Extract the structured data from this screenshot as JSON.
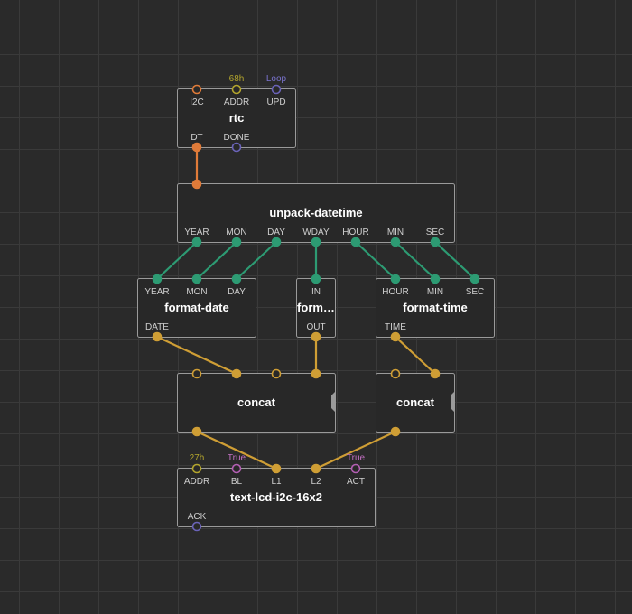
{
  "colors": {
    "background": "#2a2a2a",
    "grid_line": "#3a3a3a",
    "pulse": "#6a63b8",
    "i2c": "#e07b39",
    "datetime": "#2d9b73",
    "string": "#cf9e35",
    "boolean": "#b35fb3",
    "byte": "#b3a52d"
  },
  "nodes": {
    "rtc": {
      "title": "rtc",
      "inputs": [
        {
          "label": "I2C",
          "value": ""
        },
        {
          "label": "ADDR",
          "value": "68h"
        },
        {
          "label": "UPD",
          "value": "Loop"
        }
      ],
      "outputs": [
        {
          "label": "DT"
        },
        {
          "label": "DONE"
        }
      ]
    },
    "unpack": {
      "title": "unpack-datetime",
      "outputs": [
        {
          "label": "YEAR"
        },
        {
          "label": "MON"
        },
        {
          "label": "DAY"
        },
        {
          "label": "WDAY"
        },
        {
          "label": "HOUR"
        },
        {
          "label": "MIN"
        },
        {
          "label": "SEC"
        }
      ]
    },
    "format_date": {
      "title": "format-date",
      "inputs": [
        {
          "label": "YEAR"
        },
        {
          "label": "MON"
        },
        {
          "label": "DAY"
        }
      ],
      "outputs": [
        {
          "label": "DATE"
        }
      ]
    },
    "format_mid": {
      "title": "form…",
      "inputs": [
        {
          "label": "IN"
        }
      ],
      "outputs": [
        {
          "label": "OUT"
        }
      ]
    },
    "format_time": {
      "title": "format-time",
      "inputs": [
        {
          "label": "HOUR"
        },
        {
          "label": "MIN"
        },
        {
          "label": "SEC"
        }
      ],
      "outputs": [
        {
          "label": "TIME"
        }
      ]
    },
    "concat1": {
      "title": "concat"
    },
    "concat2": {
      "title": "concat"
    },
    "lcd": {
      "title": "text-lcd-i2c-16x2",
      "inputs": [
        {
          "label": "ADDR",
          "value": "27h"
        },
        {
          "label": "BL",
          "value": "True"
        },
        {
          "label": "L1",
          "value": ""
        },
        {
          "label": "L2",
          "value": ""
        },
        {
          "label": "ACT",
          "value": "True"
        }
      ],
      "outputs": [
        {
          "label": "ACK"
        }
      ]
    }
  }
}
